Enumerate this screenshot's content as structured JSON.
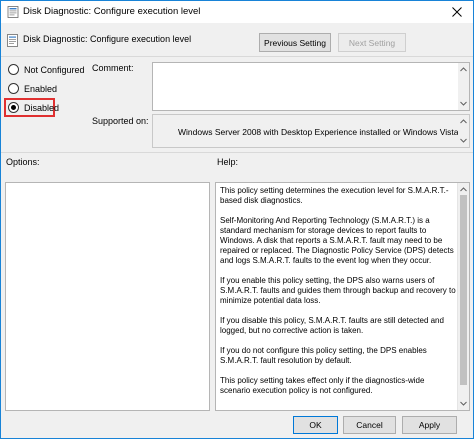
{
  "window": {
    "title": "Disk Diagnostic: Configure execution level",
    "close_icon": "close-icon",
    "app_icon": "policy-icon"
  },
  "header": {
    "title": "Disk Diagnostic: Configure execution level",
    "previous_label": "Previous Setting",
    "next_label": "Next Setting",
    "icon": "policy-setting-icon"
  },
  "state": {
    "options": [
      {
        "label": "Not Configured",
        "checked": false
      },
      {
        "label": "Enabled",
        "checked": false
      },
      {
        "label": "Disabled",
        "checked": true
      }
    ],
    "highlight_color": "#e03030"
  },
  "comment": {
    "label": "Comment:",
    "value": ""
  },
  "supported": {
    "label": "Supported on:",
    "value": "Windows Server 2008 with Desktop Experience installed or Windows Vista"
  },
  "options_section": {
    "label": "Options:"
  },
  "help_section": {
    "label": "Help:",
    "paragraphs": [
      "This policy setting determines the execution level for S.M.A.R.T.-based disk diagnostics.",
      "Self-Monitoring And Reporting Technology (S.M.A.R.T.) is a standard mechanism for storage devices to report faults to Windows. A disk that reports a S.M.A.R.T. fault may need to be repaired or replaced. The Diagnostic Policy Service (DPS) detects and logs S.M.A.R.T. faults to the event log when they occur.",
      "If you enable this policy setting, the DPS also warns users of S.M.A.R.T. faults and guides them through backup and recovery to minimize potential data loss.",
      "If you disable this policy, S.M.A.R.T. faults are still detected and logged, but no corrective action is taken.",
      "If you do not configure this policy setting, the DPS enables S.M.A.R.T. fault resolution by default.",
      "This policy setting takes effect only if the diagnostics-wide scenario execution policy is not configured."
    ]
  },
  "footer": {
    "ok_label": "OK",
    "cancel_label": "Cancel",
    "apply_label": "Apply"
  },
  "colors": {
    "accent": "#0078d7",
    "window_border": "#1883d7"
  }
}
